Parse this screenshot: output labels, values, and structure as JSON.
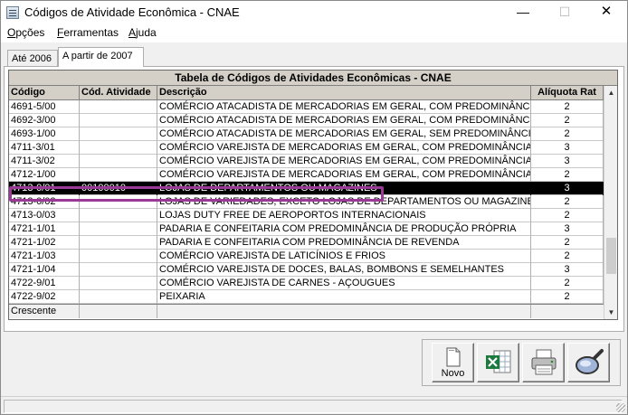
{
  "window": {
    "title": "Códigos de Atividade Econômica - CNAE",
    "controls": {
      "minimize": "—",
      "maximize": "☐",
      "close": "✕"
    }
  },
  "menu": [
    {
      "label": "Opções",
      "underline": "O",
      "rest": "pções"
    },
    {
      "label": "Ferramentas",
      "underline": "F",
      "rest": "erramentas"
    },
    {
      "label": "Ajuda",
      "underline": "A",
      "rest": "juda"
    }
  ],
  "tabs": [
    {
      "label": "Até 2006",
      "active": false
    },
    {
      "label": "A partir de 2007",
      "active": true
    }
  ],
  "grid": {
    "caption": "Tabela de Códigos de Atividades Econômicas - CNAE",
    "columns": [
      "Código",
      "Cód. Atividade",
      "Descrição",
      "Alíquota Rat"
    ],
    "rows": [
      {
        "codigo": "4691-5/00",
        "atividade": "",
        "descricao": "COMÉRCIO ATACADISTA DE MERCADORIAS EM GERAL, COM PREDOMINÂNCIA",
        "aliquota": "2"
      },
      {
        "codigo": "4692-3/00",
        "atividade": "",
        "descricao": "COMÉRCIO ATACADISTA DE MERCADORIAS EM GERAL, COM PREDOMINÂNCIA",
        "aliquota": "2"
      },
      {
        "codigo": "4693-1/00",
        "atividade": "",
        "descricao": "COMÉRCIO ATACADISTA DE MERCADORIAS EM GERAL, SEM PREDOMINÂNCIA",
        "aliquota": "2"
      },
      {
        "codigo": "4711-3/01",
        "atividade": "",
        "descricao": "COMÉRCIO VAREJISTA DE MERCADORIAS EM GERAL, COM PREDOMINÂNCIA D",
        "aliquota": "3"
      },
      {
        "codigo": "4711-3/02",
        "atividade": "",
        "descricao": "COMÉRCIO VAREJISTA DE MERCADORIAS EM GERAL, COM PREDOMINÂNCIA D",
        "aliquota": "3"
      },
      {
        "codigo": "4712-1/00",
        "atividade": "",
        "descricao": "COMÉRCIO VAREJISTA DE MERCADORIAS EM GERAL, COM PREDOMINÂNCIA D",
        "aliquota": "2"
      },
      {
        "codigo": "4713-0/01",
        "atividade": "00100010",
        "descricao": "LOJAS DE DEPARTAMENTOS OU MAGAZINES",
        "aliquota": "3",
        "selected": true
      },
      {
        "codigo": "4713-0/02",
        "atividade": "",
        "descricao": "LOJAS DE VARIEDADES, EXCETO LOJAS DE DEPARTAMENTOS OU MAGAZINES",
        "aliquota": "2"
      },
      {
        "codigo": "4713-0/03",
        "atividade": "",
        "descricao": "LOJAS DUTY FREE DE AEROPORTOS INTERNACIONAIS",
        "aliquota": "2"
      },
      {
        "codigo": "4721-1/01",
        "atividade": "",
        "descricao": "PADARIA E CONFEITARIA COM PREDOMINÂNCIA DE PRODUÇÃO PRÓPRIA",
        "aliquota": "3"
      },
      {
        "codigo": "4721-1/02",
        "atividade": "",
        "descricao": "PADARIA E CONFEITARIA COM PREDOMINÂNCIA DE REVENDA",
        "aliquota": "2"
      },
      {
        "codigo": "4721-1/03",
        "atividade": "",
        "descricao": "COMÉRCIO VAREJISTA DE LATICÍNIOS E FRIOS",
        "aliquota": "2"
      },
      {
        "codigo": "4721-1/04",
        "atividade": "",
        "descricao": "COMÉRCIO VAREJISTA DE DOCES, BALAS, BOMBONS E SEMELHANTES",
        "aliquota": "3"
      },
      {
        "codigo": "4722-9/01",
        "atividade": "",
        "descricao": "COMÉRCIO VAREJISTA DE CARNES - AÇOUGUES",
        "aliquota": "2"
      },
      {
        "codigo": "4722-9/02",
        "atividade": "",
        "descricao": "PEIXARIA",
        "aliquota": "2"
      }
    ],
    "footer": {
      "sort_label": "Crescente"
    },
    "scroll": {
      "up_icon": "▲",
      "down_icon": "▼"
    },
    "selected_color": "#000000",
    "highlight_color": "#9b3a96"
  },
  "toolbar": {
    "buttons": [
      {
        "name": "novo",
        "label": "Novo",
        "icon": "new-document-icon"
      },
      {
        "name": "excel",
        "label": "",
        "icon": "excel-export-icon"
      },
      {
        "name": "print",
        "label": "",
        "icon": "printer-icon"
      },
      {
        "name": "search",
        "label": "",
        "icon": "magnifier-icon"
      }
    ]
  }
}
